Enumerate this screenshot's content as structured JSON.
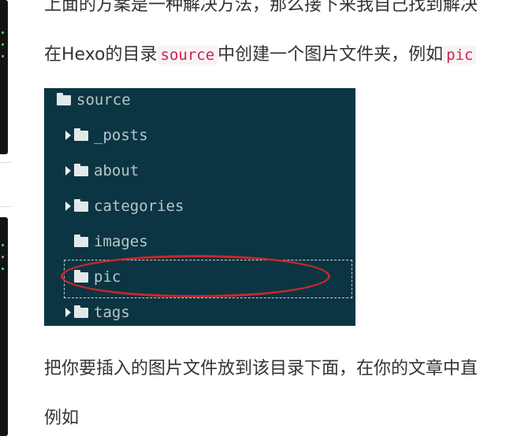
{
  "article": {
    "para1": "上面的方案是一种解决方法，那么接下来我自己找到解决",
    "para2_before": "在Hexo的目录",
    "para2_code1": "source",
    "para2_middle": "中创建一个图片文件夹，例如",
    "para2_code2": "pic",
    "para3": "把你要插入的图片文件放到该目录下面，在你的文章中直",
    "para4": "例如"
  },
  "file_tree": {
    "root": "source",
    "items": [
      {
        "name": "_posts",
        "expandable": true
      },
      {
        "name": "about",
        "expandable": true
      },
      {
        "name": "categories",
        "expandable": true
      },
      {
        "name": "images",
        "expandable": false
      },
      {
        "name": "pic",
        "expandable": false,
        "selected": true
      },
      {
        "name": "tags",
        "expandable": true
      }
    ]
  },
  "colors": {
    "tree_background": "#0b3542",
    "highlight_circle": "#c62828",
    "code_text": "#c7254e"
  }
}
